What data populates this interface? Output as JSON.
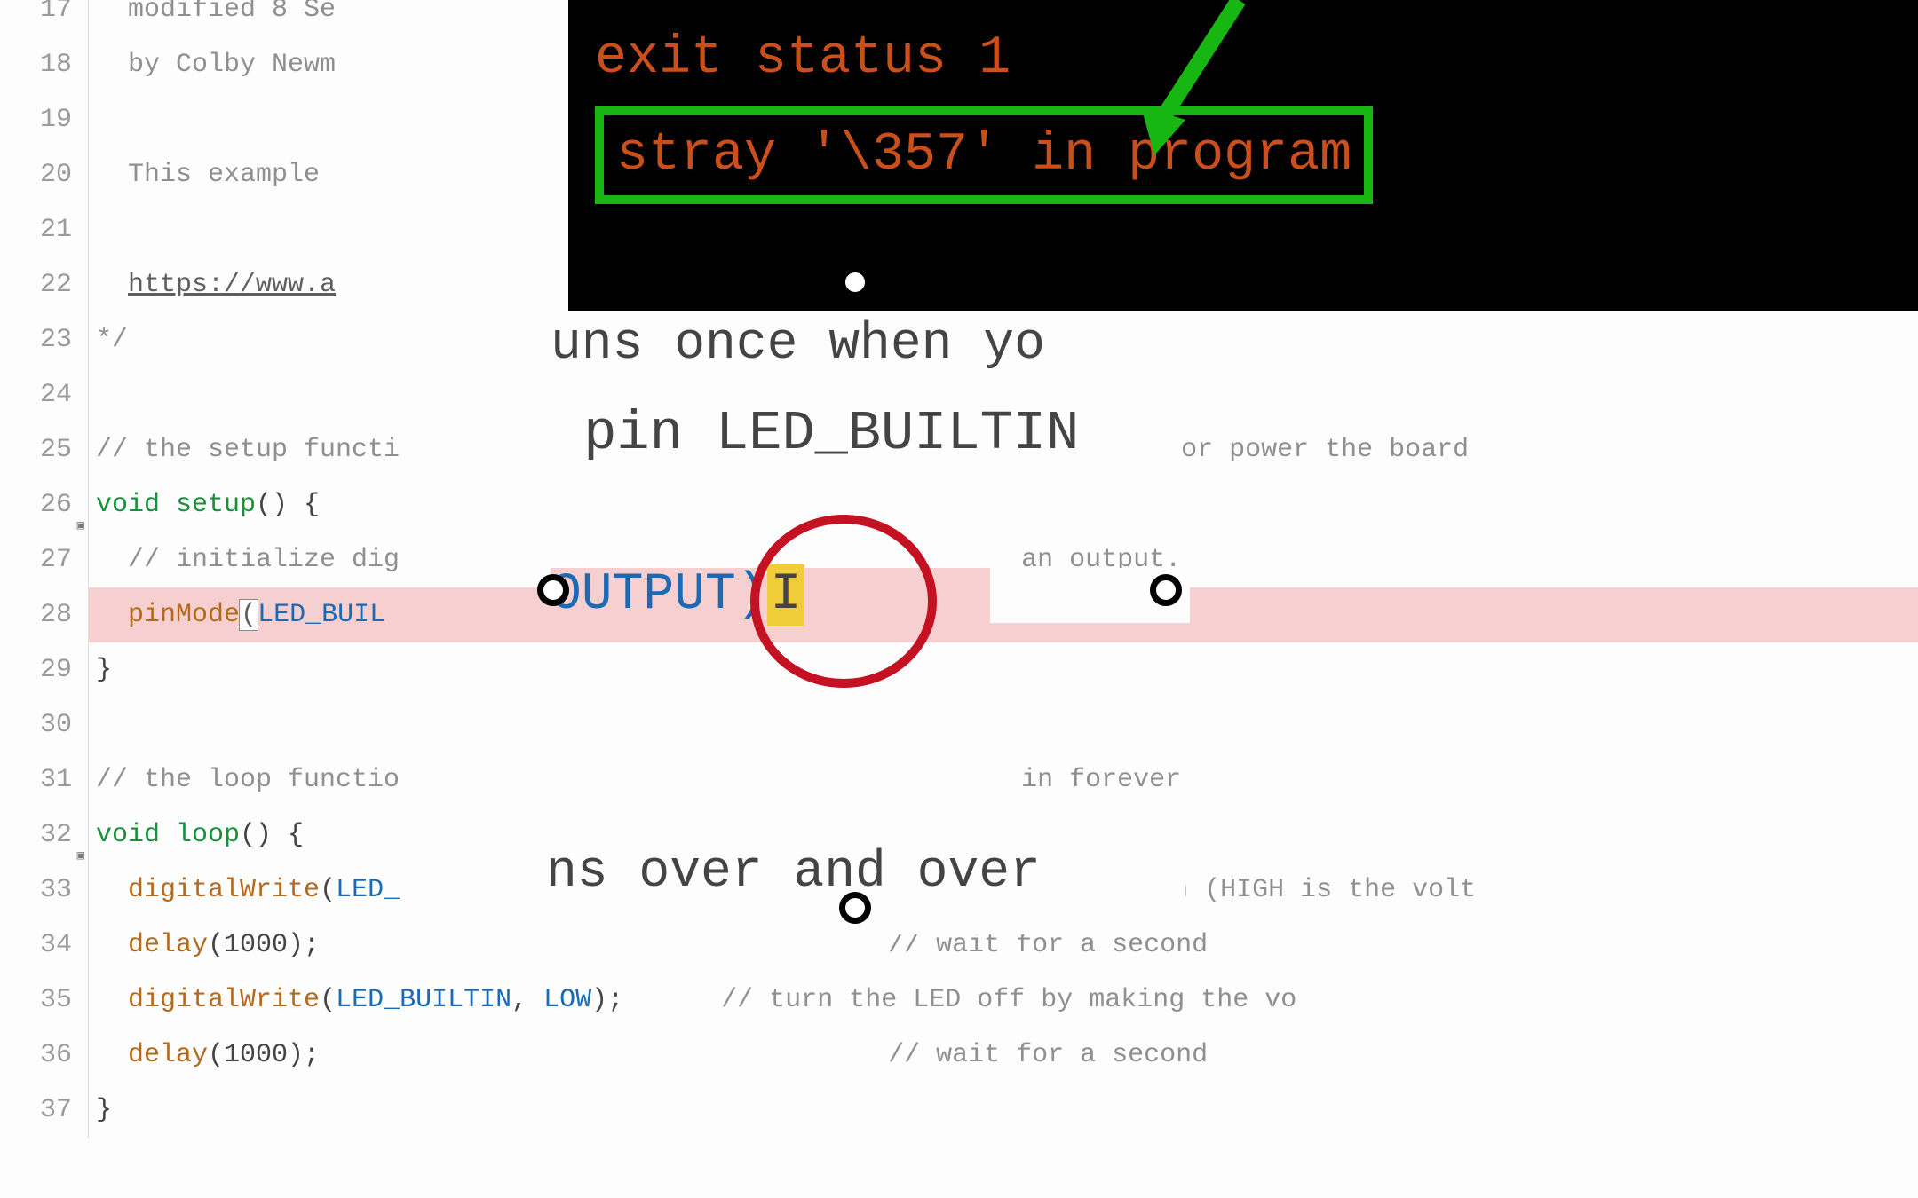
{
  "lines": {
    "l17": {
      "num": "17",
      "text": "  modified 8 Se"
    },
    "l18": {
      "num": "18",
      "text": "  by Colby Newm"
    },
    "l19": {
      "num": "19",
      "text": ""
    },
    "l20": {
      "num": "20",
      "text": "  This example"
    },
    "l21": {
      "num": "21",
      "text": ""
    },
    "l22": {
      "num": "22",
      "link": "https://www.a"
    },
    "l23": {
      "num": "23",
      "text": "*/"
    },
    "l24": {
      "num": "24",
      "text": ""
    },
    "l25": {
      "num": "25",
      "pre": "// the setup functi",
      "post": "ess reset or power the board"
    },
    "l26": {
      "num": "26",
      "kw": "void",
      "fn": "setup",
      "rest": "() {"
    },
    "l27": {
      "num": "27",
      "pre": "  // initialize dig",
      "post": "an output."
    },
    "l28": {
      "num": "28",
      "fn": "pinMode",
      "open": "(",
      "arg": "LED_BUIL"
    },
    "l29": {
      "num": "29",
      "text": "}"
    },
    "l30": {
      "num": "30",
      "text": ""
    },
    "l31": {
      "num": "31",
      "pre": "// the loop functio",
      "post": "in forever"
    },
    "l32": {
      "num": "32",
      "kw": "void",
      "fn": "loop",
      "rest": "() {"
    },
    "l33": {
      "num": "33",
      "fn": "digitalWrite",
      "open": "(",
      "arg": "LED_",
      "post": " the LED on (HIGH is the volt"
    },
    "l34": {
      "num": "34",
      "fn": "delay",
      "args": "(1000);",
      "cmt": "// wait for a second"
    },
    "l35": {
      "num": "35",
      "fn": "digitalWrite",
      "open": "(",
      "arg1": "LED_BUILTIN",
      "comma": ", ",
      "arg2": "LOW",
      "close": ");",
      "cmt": "// turn the LED off by making the vo"
    },
    "l36": {
      "num": "36",
      "fn": "delay",
      "args": "(1000);",
      "cmt": "// wait for a second"
    },
    "l37": {
      "num": "37",
      "text": "}"
    }
  },
  "error_panel": {
    "line1": "exit status 1",
    "line2": "stray '\\357' in program"
  },
  "zoom": {
    "line1": "uns once when yo",
    "line2": " pin LED_BUILTIN",
    "hl_pre": "OUTPUT)",
    "hl_cursor": "I",
    "line4": "ns over and over"
  }
}
